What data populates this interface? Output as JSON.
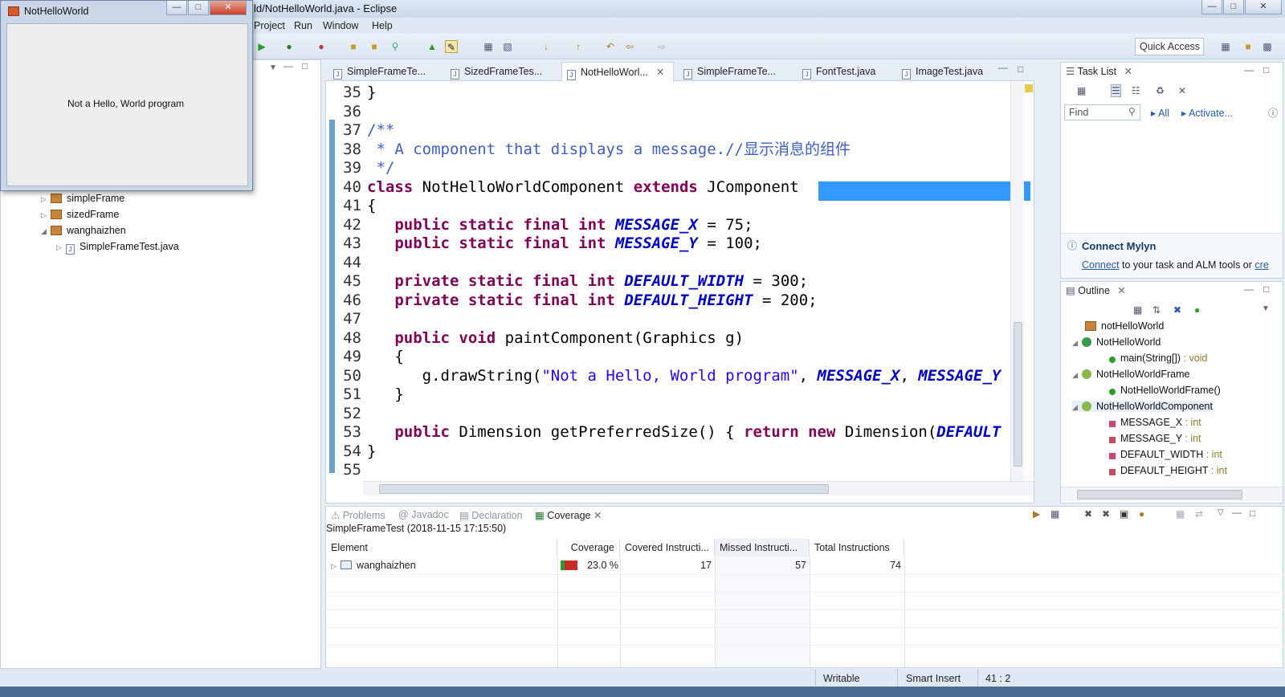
{
  "window": {
    "title": "ld/NotHelloWorld.java - Eclipse"
  },
  "menu": [
    "Project",
    "Run",
    "Window",
    "Help"
  ],
  "toolbar": {
    "quick_access": "Quick Access"
  },
  "popup": {
    "title": "NotHelloWorld",
    "message": "Not a Hello, World program"
  },
  "explorer": {
    "items": [
      {
        "label": "simpleFrame",
        "kind": "package"
      },
      {
        "label": "sizedFrame",
        "kind": "package"
      },
      {
        "label": "wanghaizhen",
        "kind": "package"
      },
      {
        "label": "SimpleFrameTest.java",
        "kind": "file"
      }
    ]
  },
  "editor_tabs": [
    "SimpleFrameTe...",
    "SizedFrameTes...",
    "NotHelloWorl...",
    "SimpleFrameTe...",
    "FontTest.java",
    "ImageTest.java"
  ],
  "code": [
    {
      "n": "35",
      "t": "}"
    },
    {
      "n": "36",
      "t": ""
    },
    {
      "n": "37",
      "t": "/**"
    },
    {
      "n": "38",
      "t": " * A component that displays a message.//显示消息的组件"
    },
    {
      "n": "39",
      "t": " */"
    },
    {
      "n": "40",
      "t": "class NotHelloWorldComponent extends JComponent"
    },
    {
      "n": "41",
      "t": "{"
    },
    {
      "n": "42",
      "t": "   public static final int MESSAGE_X = 75;"
    },
    {
      "n": "43",
      "t": "   public static final int MESSAGE_Y = 100;"
    },
    {
      "n": "44",
      "t": ""
    },
    {
      "n": "45",
      "t": "   private static final int DEFAULT_WIDTH = 300;"
    },
    {
      "n": "46",
      "t": "   private static final int DEFAULT_HEIGHT = 200;"
    },
    {
      "n": "47",
      "t": ""
    },
    {
      "n": "48",
      "t": "   public void paintComponent(Graphics g)"
    },
    {
      "n": "49",
      "t": "   {"
    },
    {
      "n": "50",
      "t": "      g.drawString(\"Not a Hello, World program\", MESSAGE_X, MESSAGE_Y"
    },
    {
      "n": "51",
      "t": "   }"
    },
    {
      "n": "52",
      "t": ""
    },
    {
      "n": "53",
      "t": "   public Dimension getPreferredSize() { return new Dimension(DEFAULT"
    },
    {
      "n": "54",
      "t": "}"
    },
    {
      "n": "55",
      "t": ""
    }
  ],
  "tasklist": {
    "tab": "Task List",
    "find": "Find",
    "all": "All",
    "activate": "Activate...",
    "mylyn_title": "Connect Mylyn",
    "mylyn_link": "Connect",
    "mylyn_text": " to your task and ALM tools or ",
    "mylyn_tail": "cre"
  },
  "outline": {
    "tab": "Outline",
    "items": [
      {
        "label": "notHelloWorld",
        "type": ""
      },
      {
        "label": "NotHelloWorld",
        "type": ""
      },
      {
        "label": "main(String[])",
        "type": " : void"
      },
      {
        "label": "NotHelloWorldFrame",
        "type": ""
      },
      {
        "label": "NotHelloWorldFrame()",
        "type": ""
      },
      {
        "label": "NotHelloWorldComponent",
        "type": ""
      },
      {
        "label": "MESSAGE_X",
        "type": " : int"
      },
      {
        "label": "MESSAGE_Y",
        "type": " : int"
      },
      {
        "label": "DEFAULT_WIDTH",
        "type": " : int"
      },
      {
        "label": "DEFAULT_HEIGHT",
        "type": " : int"
      }
    ]
  },
  "bottom": {
    "tabs": [
      "Problems",
      "Javadoc",
      "Declaration",
      "Coverage"
    ],
    "session": "SimpleFrameTest (2018-11-15 17:15:50)",
    "headers": [
      "Element",
      "Coverage",
      "Covered Instructi...",
      "Missed Instructi...",
      "Total Instructions"
    ],
    "row": {
      "element": "wanghaizhen",
      "coverage": "23.0 %",
      "covered": "17",
      "missed": "57",
      "total": "74",
      "coverage_fraction": 0.23
    }
  },
  "status": {
    "writable": "Writable",
    "insert": "Smart Insert",
    "position": "41 : 2"
  },
  "colors": {
    "keyword": "#7f0055",
    "comment": "#3f5fbf",
    "string": "#2a00ff",
    "field": "#0000c0",
    "selection": "#3399ff"
  }
}
